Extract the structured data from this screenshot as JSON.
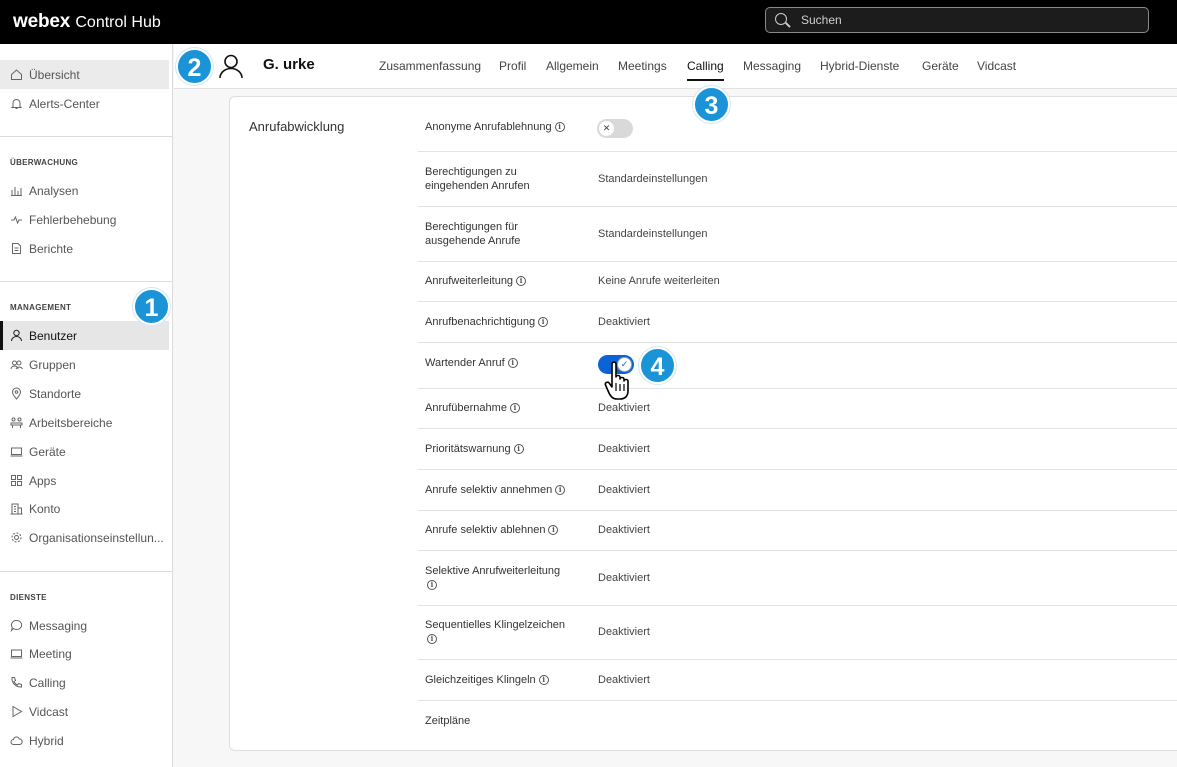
{
  "app": {
    "brand": "webex",
    "product": "Control Hub"
  },
  "search": {
    "placeholder": "Suchen"
  },
  "sidebar": {
    "top_items": [
      {
        "label": "Übersicht",
        "icon": "home-icon"
      },
      {
        "label": "Alerts-Center",
        "icon": "bell-icon"
      }
    ],
    "monitoring": {
      "heading": "ÜBERWACHUNG",
      "items": [
        {
          "label": "Analysen",
          "icon": "analytics-icon"
        },
        {
          "label": "Fehlerbehebung",
          "icon": "pulse-icon"
        },
        {
          "label": "Berichte",
          "icon": "report-icon"
        }
      ]
    },
    "management": {
      "heading": "MANAGEMENT",
      "items": [
        {
          "label": "Benutzer",
          "icon": "user-icon"
        },
        {
          "label": "Gruppen",
          "icon": "group-icon"
        },
        {
          "label": "Standorte",
          "icon": "location-icon"
        },
        {
          "label": "Arbeitsbereiche",
          "icon": "workspace-icon"
        },
        {
          "label": "Geräte",
          "icon": "device-icon"
        },
        {
          "label": "Apps",
          "icon": "apps-icon"
        },
        {
          "label": "Konto",
          "icon": "account-icon"
        },
        {
          "label": "Organisationseinstellun...",
          "icon": "gear-icon"
        }
      ]
    },
    "services": {
      "heading": "DIENSTE",
      "items": [
        {
          "label": "Messaging",
          "icon": "chat-icon"
        },
        {
          "label": "Meeting",
          "icon": "meeting-icon"
        },
        {
          "label": "Calling",
          "icon": "phone-icon"
        },
        {
          "label": "Vidcast",
          "icon": "vidcast-icon"
        },
        {
          "label": "Hybrid",
          "icon": "cloud-icon"
        }
      ]
    }
  },
  "header": {
    "user_name": "G. urke",
    "tabs": [
      "Zusammenfassung",
      "Profil",
      "Allgemein",
      "Meetings",
      "Calling",
      "Messaging",
      "Hybrid-Dienste",
      "Geräte",
      "Vidcast"
    ],
    "active_tab": "Calling"
  },
  "main": {
    "section_title": "Anrufabwicklung",
    "rows": [
      {
        "label": "Anonyme Anrufablehnung",
        "info": true,
        "toggle": "off"
      },
      {
        "label_line1": "Berechtigungen zu",
        "label_line2": "eingehenden Anrufen",
        "value": "Standardeinstellungen"
      },
      {
        "label_line1": "Berechtigungen für",
        "label_line2": "ausgehende Anrufe",
        "value": "Standardeinstellungen"
      },
      {
        "label": "Anrufweiterleitung",
        "info": true,
        "value": "Keine Anrufe weiterleiten"
      },
      {
        "label": "Anrufbenachrichtigung",
        "info": true,
        "value": "Deaktiviert"
      },
      {
        "label": "Wartender Anruf",
        "info": true,
        "toggle": "on"
      },
      {
        "label": "Anrufübernahme",
        "info": true,
        "value": "Deaktiviert"
      },
      {
        "label": "Prioritätswarnung",
        "info": true,
        "value": "Deaktiviert"
      },
      {
        "label": "Anrufe selektiv annehmen",
        "info": true,
        "value": "Deaktiviert"
      },
      {
        "label": "Anrufe selektiv ablehnen",
        "info": true,
        "value": "Deaktiviert"
      },
      {
        "label": "Selektive Anrufweiterleitung",
        "info": true,
        "value": "Deaktiviert"
      },
      {
        "label": "Sequentielles Klingelzeichen",
        "info": true,
        "value": "Deaktiviert"
      },
      {
        "label": "Gleichzeitiges Klingeln",
        "info": true,
        "value": "Deaktiviert"
      },
      {
        "label": "Zeitpläne"
      }
    ]
  },
  "info_glyph": "i",
  "toggle_glyphs": {
    "off": "✕",
    "on": "✓"
  },
  "badges": [
    "1",
    "2",
    "3",
    "4"
  ],
  "colors": {
    "accent_blue": "#0b63d6",
    "badge_blue": "#1a94d6",
    "topbar": "#000000"
  }
}
